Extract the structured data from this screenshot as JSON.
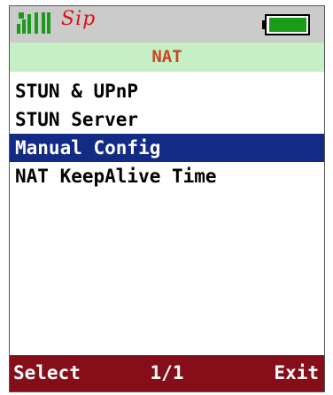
{
  "status": {
    "logo": "Sip",
    "signal_icon": "signal-bars-icon",
    "battery_icon": "battery-full-icon",
    "battery_level": 1.0
  },
  "title": "NAT",
  "menu": {
    "items": [
      {
        "label": "STUN & UPnP"
      },
      {
        "label": "STUN Server"
      },
      {
        "label": "Manual Config"
      },
      {
        "label": "NAT KeepAlive Time"
      }
    ],
    "selected_index": 2
  },
  "softkeys": {
    "left": "Select",
    "center": "1/1",
    "right": "Exit"
  },
  "colors": {
    "status_bg": "#cbcbcb",
    "title_bg": "#c6efc6",
    "title_text": "#c8461f",
    "selection_bg": "#122b84",
    "softkey_bg": "#860e18",
    "battery_fill": "#1a9b1a",
    "signal": "#1a9b1a",
    "logo": "#d8141a"
  }
}
